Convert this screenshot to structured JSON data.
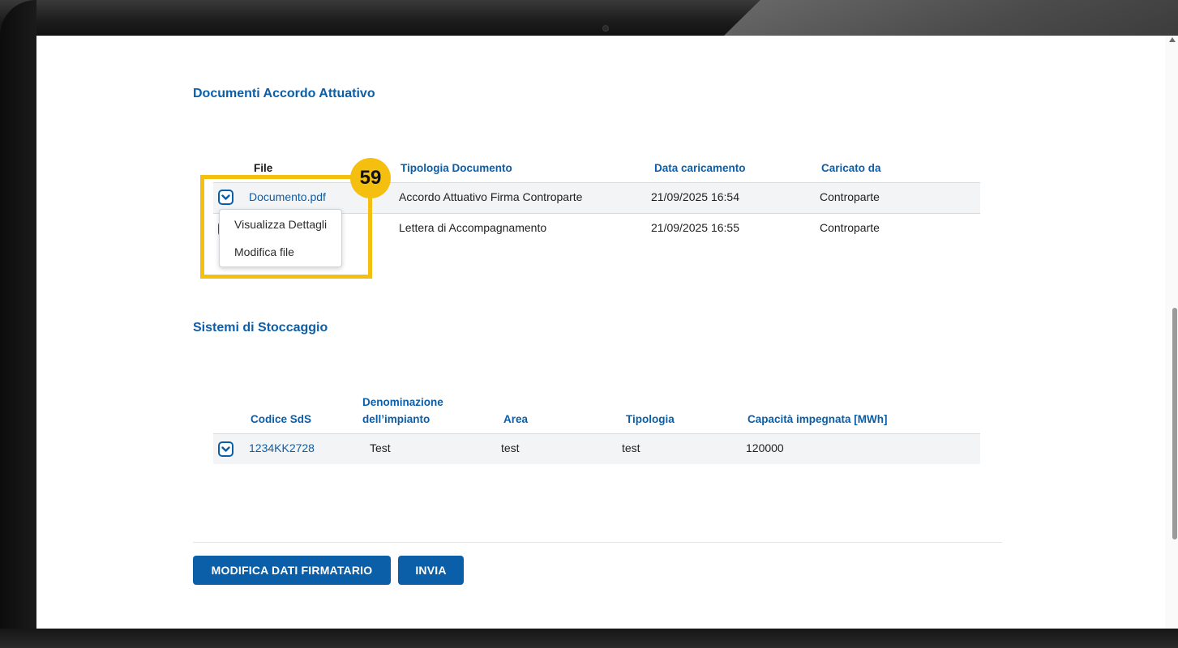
{
  "documenti": {
    "title": "Documenti Accordo Attuativo",
    "headers": {
      "file": "File",
      "tipologia": "Tipologia Documento",
      "data": "Data caricamento",
      "caricato": "Caricato da"
    },
    "rows": [
      {
        "file": "Documento.pdf",
        "tipologia": "Accordo Attuativo Firma Controparte",
        "data": "21/09/2025 16:54",
        "caricato": "Controparte"
      },
      {
        "file": "",
        "tipologia": "Lettera di Accompagnamento",
        "data": "21/09/2025 16:55",
        "caricato": "Controparte"
      }
    ],
    "menu": {
      "item1": "Visualizza Dettagli",
      "item2": "Modifica file"
    }
  },
  "callout": {
    "number": "59",
    "color": "#f5bf0f"
  },
  "stoccaggio": {
    "title": "Sistemi di Stoccaggio",
    "headers": {
      "codice": "Codice SdS",
      "denominazione_1": "Denominazione",
      "denominazione_2": "dell’impianto",
      "area": "Area",
      "tipologia": "Tipologia",
      "capacita": "Capacità impegnata [MWh]"
    },
    "rows": [
      {
        "codice": "1234KK2728",
        "denominazione": "Test",
        "area": "test",
        "tipologia": "test",
        "capacita": "120000"
      }
    ]
  },
  "actions": {
    "modifica": "MODIFICA DATI FIRMATARIO",
    "invia": "INVIA"
  },
  "colors": {
    "accent": "#0b5ea8",
    "highlight": "#f5bf0f"
  },
  "icons": {
    "toggle": "chevron-down-icon"
  }
}
